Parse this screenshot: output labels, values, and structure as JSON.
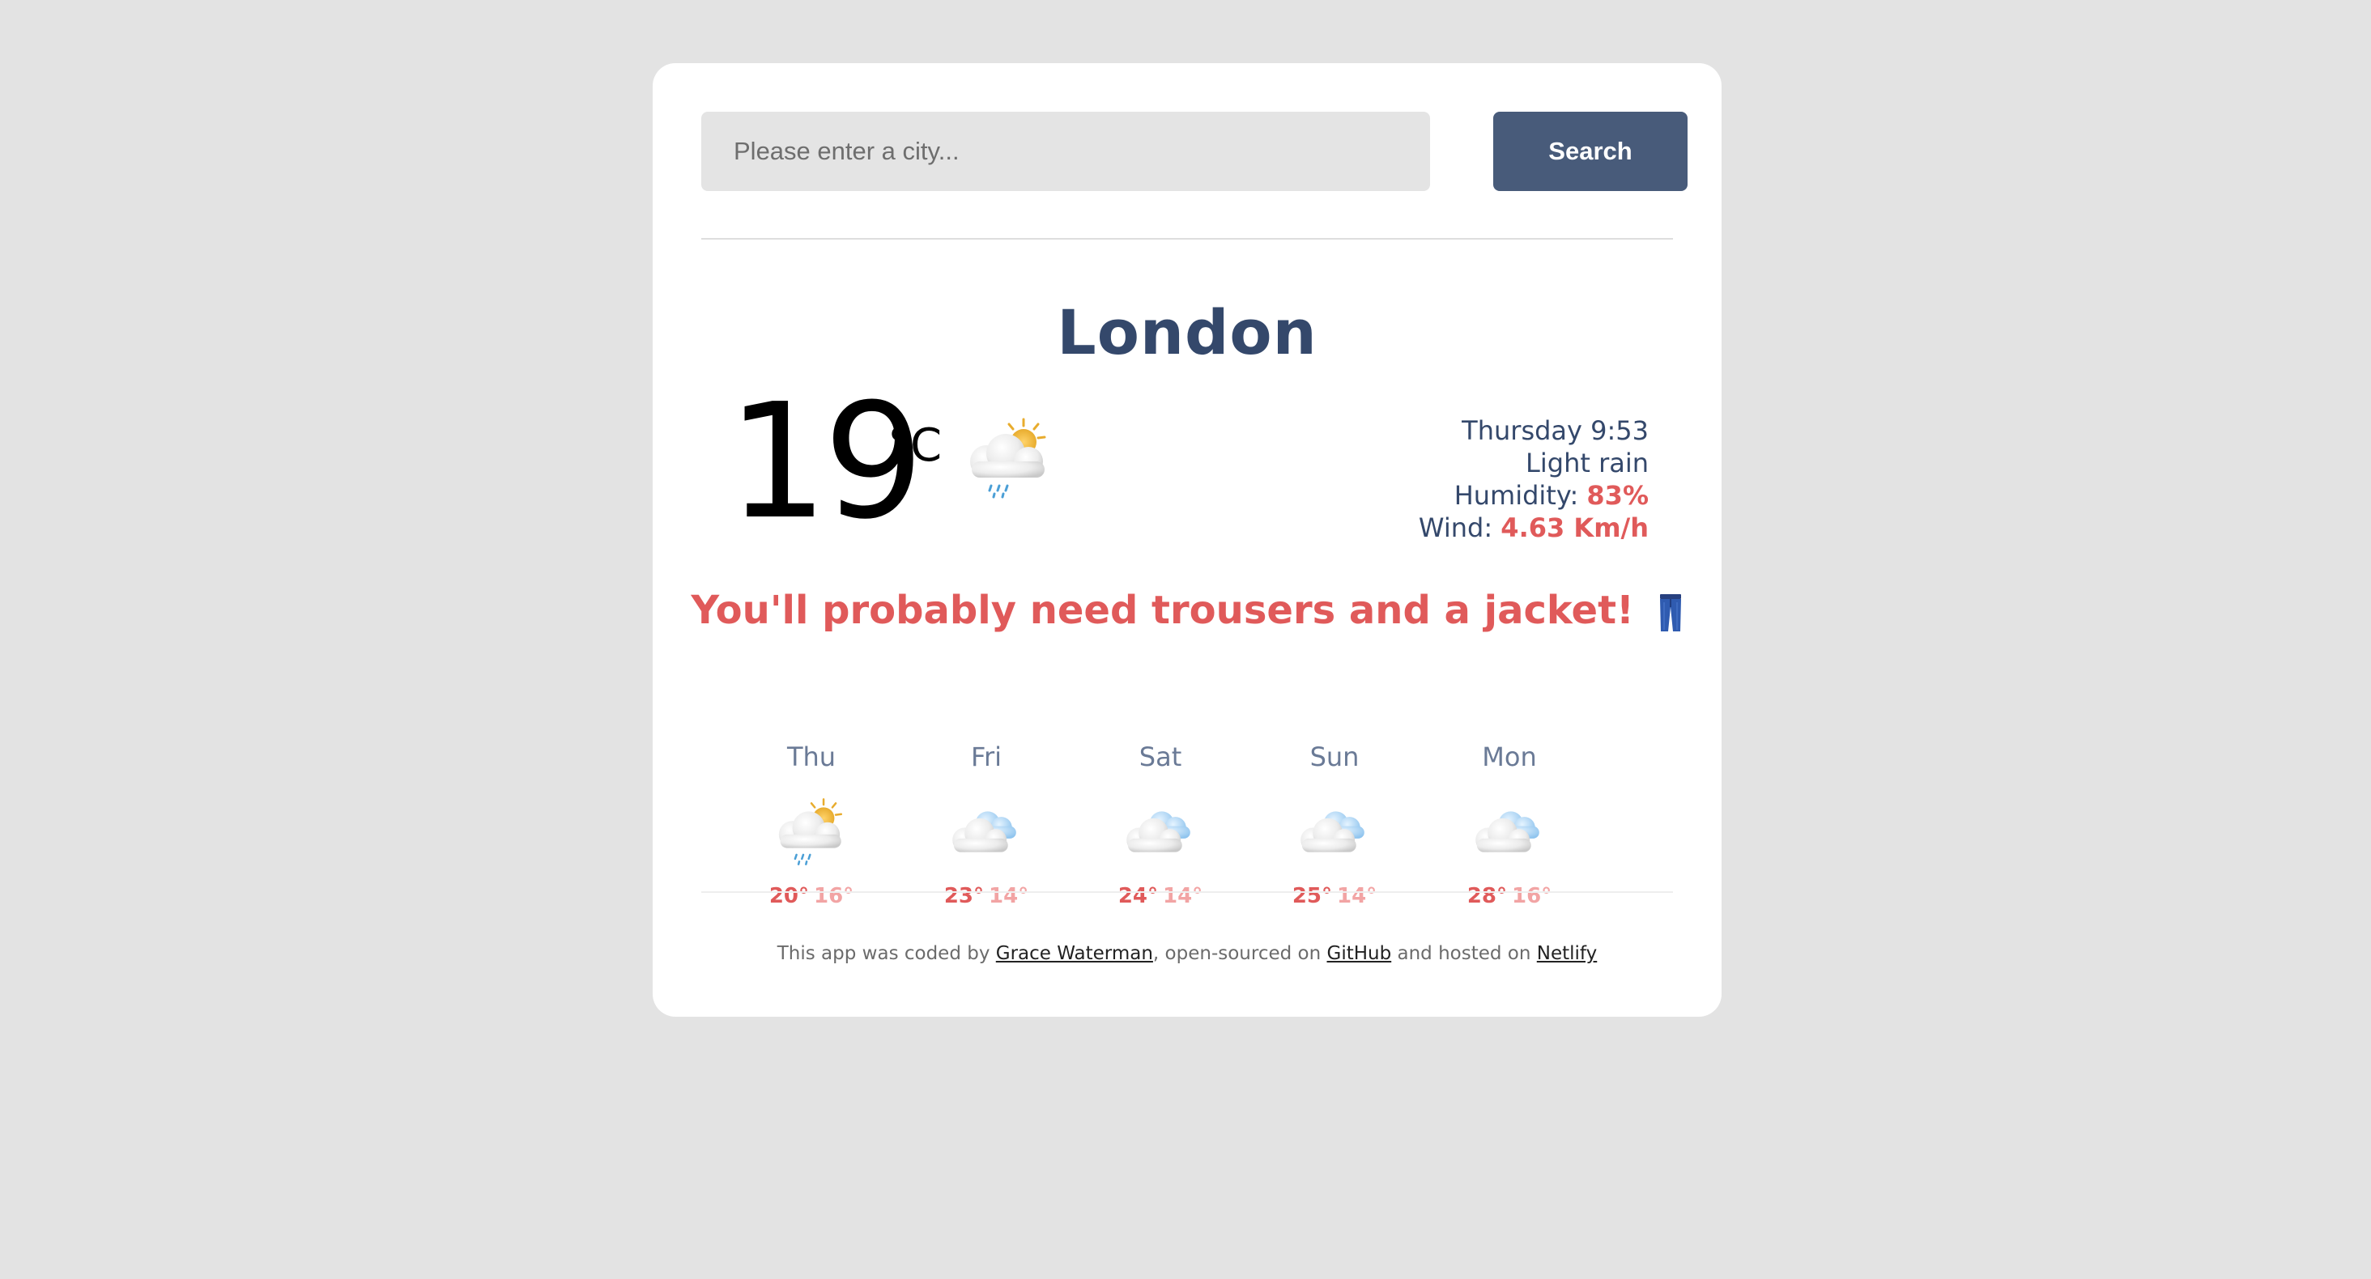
{
  "search": {
    "placeholder": "Please enter a city...",
    "button_label": "Search"
  },
  "current": {
    "city": "London",
    "temperature": "19",
    "unit": "°C",
    "icon": "rain-sun-cloud-icon",
    "day_time": "Thursday 9:53",
    "description": "Light rain",
    "humidity_label": "Humidity:",
    "humidity_value": "83%",
    "wind_label": "Wind:",
    "wind_value": "4.63 Km/h"
  },
  "advice": {
    "text": "You'll probably need trousers and a jacket!",
    "icon": "jeans-icon"
  },
  "forecast": [
    {
      "day": "Thu",
      "icon": "rain-sun-cloud-icon",
      "max": "20°",
      "min": "16°"
    },
    {
      "day": "Fri",
      "icon": "cloudy-icon",
      "max": "23°",
      "min": "14°"
    },
    {
      "day": "Sat",
      "icon": "cloudy-icon",
      "max": "24°",
      "min": "14°"
    },
    {
      "day": "Sun",
      "icon": "cloudy-icon",
      "max": "25°",
      "min": "14°"
    },
    {
      "day": "Mon",
      "icon": "cloudy-icon",
      "max": "28°",
      "min": "16°"
    }
  ],
  "footer": {
    "prefix": "This app was coded by ",
    "author_link": "Grace Waterman",
    "middle": ", open-sourced on ",
    "github_link": "GitHub",
    "middle2": " and hosted on ",
    "netlify_link": "Netlify"
  },
  "colors": {
    "accent": "#e05a5a",
    "accent_light": "#f2a4a4",
    "navy": "#34486b",
    "button": "#485b7a",
    "background": "#e3e3e3"
  }
}
